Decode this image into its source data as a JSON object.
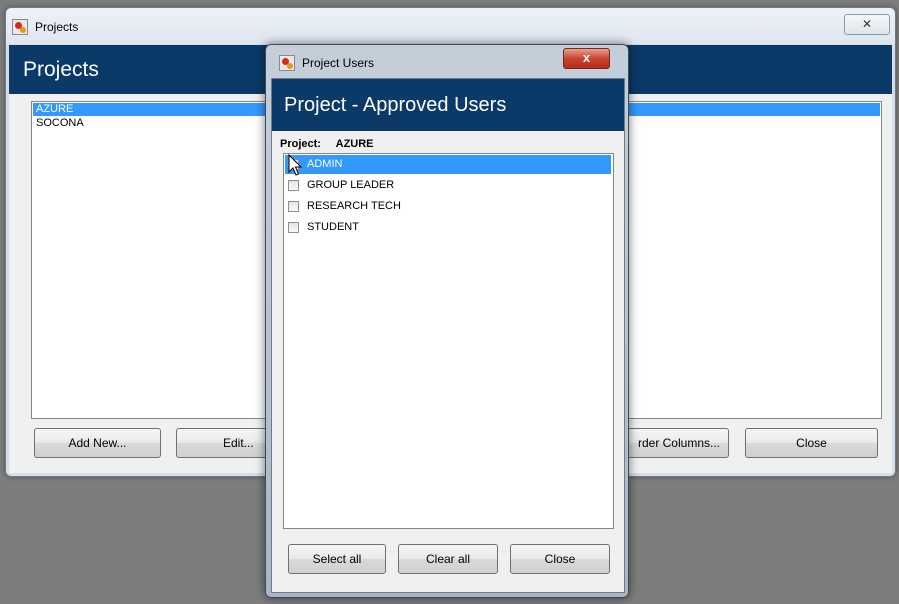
{
  "main_window": {
    "title": "Projects",
    "close_symbol": "✕",
    "header_title": "Projects",
    "projects": [
      "AZURE",
      "SOCONA"
    ],
    "selected_project_index": 0,
    "buttons": {
      "add_new": "Add New...",
      "edit": "Edit...",
      "order_columns": "rder Columns...",
      "close": "Close"
    }
  },
  "dialog": {
    "title": "Project Users",
    "close_symbol": "x",
    "header_title": "Project - Approved Users",
    "project_label": "Project:",
    "project_value": "AZURE",
    "users": [
      {
        "label": "ADMIN",
        "checked": true,
        "selected": true
      },
      {
        "label": "GROUP LEADER",
        "checked": false,
        "selected": false
      },
      {
        "label": "RESEARCH TECH",
        "checked": false,
        "selected": false
      },
      {
        "label": "STUDENT",
        "checked": false,
        "selected": false
      }
    ],
    "buttons": {
      "select_all": "Select all",
      "clear_all": "Clear all",
      "close": "Close"
    }
  },
  "colors": {
    "header_navy": "#0b3968",
    "selection_blue": "#3399ff",
    "close_red": "#c8452e"
  },
  "icons": [
    "app-icon",
    "close-icon",
    "checkbox-icon",
    "mouse-cursor-icon"
  ]
}
